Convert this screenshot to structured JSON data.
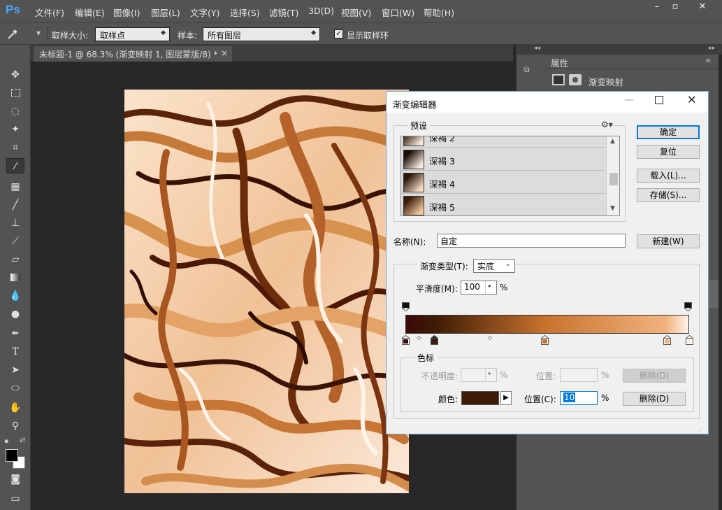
{
  "app": {
    "logo": "Ps",
    "menu": [
      "文件(F)",
      "编辑(E)",
      "图像(I)",
      "图层(L)",
      "文字(Y)",
      "选择(S)",
      "滤镜(T)",
      "3D(D)",
      "视图(V)",
      "窗口(W)",
      "帮助(H)"
    ],
    "window_controls": [
      "minimize-icon",
      "maximize-icon",
      "close-icon"
    ]
  },
  "options_bar": {
    "sample_size_label": "取样大小:",
    "sample_size_value": "取样点",
    "sample_label": "样本:",
    "sample_value": "所有图层",
    "show_ring_label": "显示取样环",
    "show_ring_checked": true
  },
  "document_tab": {
    "title": "未标题-1 @ 68.3% (渐变映射 1, 图层蒙版/8) *",
    "close": "×"
  },
  "properties_panel": {
    "tab": "属性",
    "adjustment_name": "渐变映射"
  },
  "dialog": {
    "title": "渐变编辑器",
    "presets_label": "预设",
    "presets": [
      {
        "name": "深褐 2",
        "colors": [
          "#2a1206",
          "#f5e6d6"
        ]
      },
      {
        "name": "深褐 3",
        "colors": [
          "#1a0c04",
          "#f7ebdf"
        ]
      },
      {
        "name": "深褐 4",
        "colors": [
          "#2b1508",
          "#f2dcc4"
        ]
      },
      {
        "name": "深褐 5",
        "colors": [
          "#3a1a08",
          "#f3c8a0"
        ]
      }
    ],
    "buttons": {
      "ok": "确定",
      "reset": "复位",
      "load": "载入(L)...",
      "save": "存储(S)...",
      "new": "新建(W)"
    },
    "name_label": "名称(N):",
    "name_value": "自定",
    "type_label": "渐变类型(T):",
    "type_value": "实底",
    "smooth_label": "平滑度(M):",
    "smooth_value": "100",
    "smooth_unit": "%",
    "gradient": {
      "stops": [
        {
          "pos": 0,
          "color": "#3b0a08"
        },
        {
          "pos": 10,
          "color": "#3d1b06"
        },
        {
          "pos": 49,
          "color": "#c8722c"
        },
        {
          "pos": 92,
          "color": "#f2b27e"
        },
        {
          "pos": 100,
          "color": "#fff4ea"
        }
      ],
      "opacity_stops": [
        0,
        100
      ],
      "midpoints": [
        5,
        30
      ]
    },
    "stops_group": {
      "label": "色标",
      "opacity_label": "不透明度:",
      "opacity_unit": "%",
      "position_label_disabled": "位置:",
      "position_unit_disabled": "%",
      "delete_disabled": "删除(D)",
      "color_label": "颜色:",
      "color_value": "#3d1b06",
      "position_label": "位置(C):",
      "position_value": "10",
      "position_unit": "%",
      "delete": "删除(D)"
    }
  }
}
